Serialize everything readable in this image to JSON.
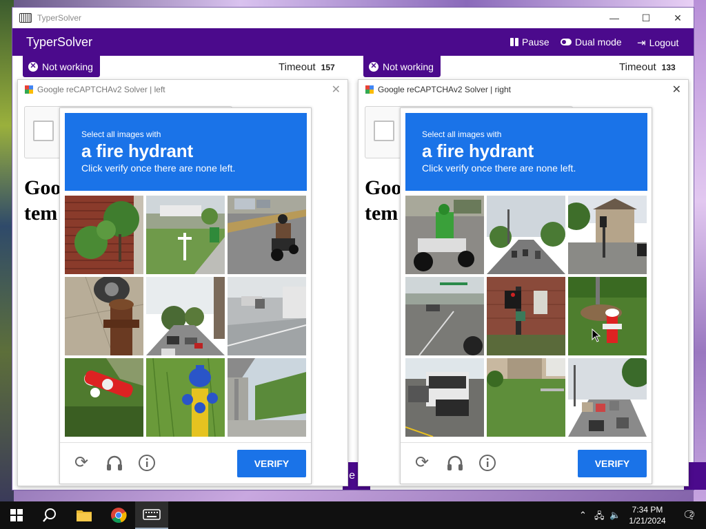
{
  "window": {
    "title": "TyperSolver",
    "min_glyph": "—",
    "max_glyph": "☐",
    "close_glyph": "✕"
  },
  "appbar": {
    "name": "TyperSolver",
    "pause_label": "Pause",
    "dual_label": "Dual mode",
    "logout_label": "Logout"
  },
  "panels": {
    "left": {
      "status": "Not working",
      "timeout_label": "Timeout",
      "timeout_value": "157",
      "solver_title": "Google reCAPTCHAv2 Solver | left",
      "page_text_1": "Goo",
      "page_text_2": "tem",
      "strip_char": "e C"
    },
    "right": {
      "status": "Not working",
      "timeout_label": "Timeout",
      "timeout_value": "133",
      "solver_title": "Google reCAPTCHAv2 Solver | right",
      "page_text_1": "Goo",
      "page_text_2": "tem"
    }
  },
  "challenge": {
    "line1": "Select all images with",
    "line2": "a fire hydrant",
    "line3": "Click verify once there are none left.",
    "verify_label": "VERIFY",
    "colors": {
      "accent": "#1a73e8",
      "brand": "#4b0a8c"
    }
  },
  "tiles": {
    "left": [
      "house-with-shrub",
      "street-with-mailbox",
      "motorcycle-rider",
      "rusty-fire-hydrant",
      "street-with-cars",
      "highway-overpass",
      "red-white-fire-hydrant",
      "yellow-blue-fire-hydrant",
      "grass-embankment-bridge"
    ],
    "right": [
      "motorcycle-rider-green",
      "city-street-traffic",
      "street-intersection-house",
      "road-with-train",
      "traffic-light-brick-building",
      "red-white-fire-hydrant-lawn",
      "bus-and-cars-street",
      "grassy-yard",
      "busy-street-traffic"
    ]
  },
  "taskbar": {
    "time": "7:34 PM",
    "date": "1/21/2024",
    "notifications": "2",
    "items": [
      "start-icon",
      "search-icon",
      "file-explorer-icon",
      "chrome-icon",
      "typersolver-icon"
    ]
  }
}
